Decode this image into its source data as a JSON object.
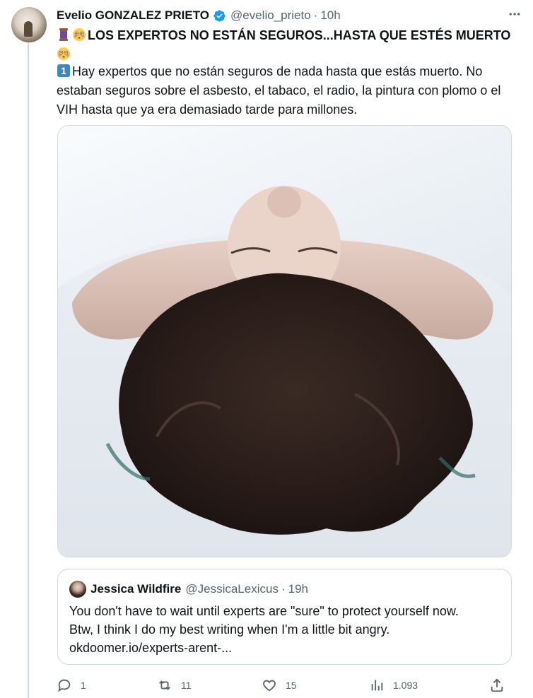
{
  "tweet": {
    "author_name": "Evelio GONZALEZ PRIETO",
    "handle": "@evelio_prieto",
    "separator": "·",
    "time": "10h",
    "title_text": "LOS EXPERTOS NO ESTÁN SEGUROS...HASTA QUE ESTÉS MUERTO",
    "body_text": "Hay expertos que no están seguros de nada hasta que estás muerto. No estaban seguros sobre el asbesto, el tabaco, el radio, la pintura con plomo o el VIH hasta que ya era demasiado tarde para millones.",
    "icons": {
      "verified": "verified-badge-icon",
      "more": "more-options-icon",
      "thread": "thread-emoji-icon",
      "flushed": "flushed-face-emoji-icon",
      "keycap": "keycap-one-emoji-icon"
    },
    "media_description_icon": "photo"
  },
  "quote": {
    "author_name": "Jessica Wildfire",
    "handle": "@JessicaLexicus",
    "separator": "·",
    "time": "19h",
    "text_line1": "You don't have to wait until experts are \"sure\" to protect yourself now.",
    "text_line2": "Btw, I think I do my best writing when I'm a little bit angry.",
    "link": "okdoomer.io/experts-arent-..."
  },
  "actions": {
    "replies": "1",
    "retweets": "11",
    "likes": "15",
    "views": "1.093"
  },
  "colors": {
    "accent": "#1d9bf0",
    "muted": "#536471",
    "border": "#cfd9de"
  }
}
